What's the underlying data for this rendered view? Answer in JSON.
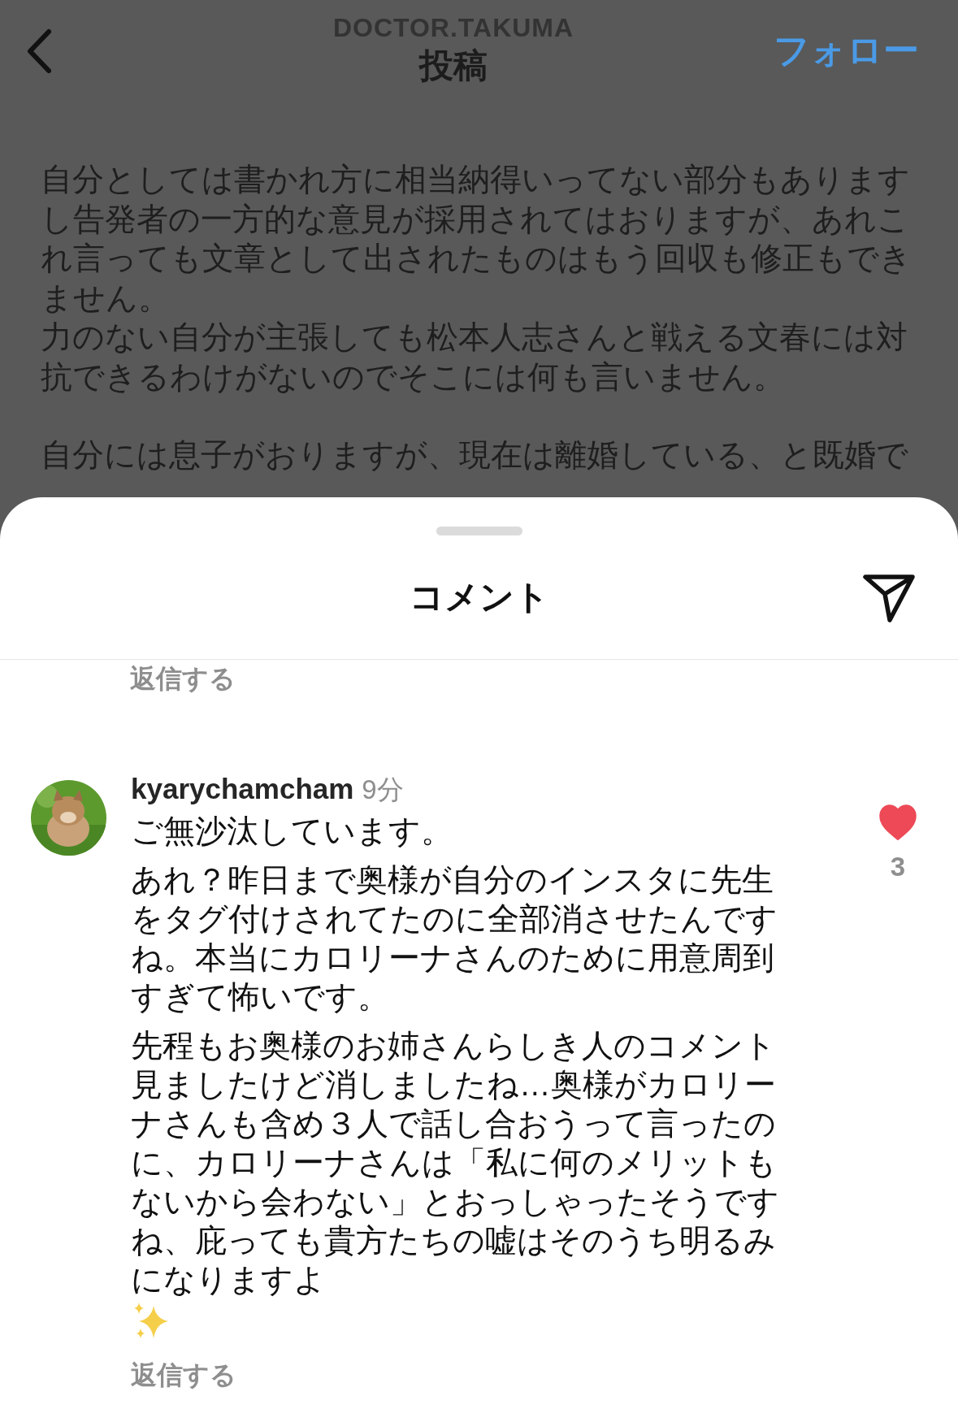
{
  "header": {
    "account": "DOCTOR.TAKUMA",
    "title": "投稿",
    "follow": "フォロー"
  },
  "post": {
    "sections": [
      [
        "自分としては書かれ方に相当納得いってない部分もありますし告発者の一方的な意見が採用されてはおりますが、あれこれ言っても文章として出されたものはもう回収も修正もできません。",
        "力のない自分が主張しても松本人志さんと戦える文春には対抗できるわけがないのでそこには何も言いません。"
      ],
      [
        "自分には息子がおりますが、現在は離婚している、と既婚で"
      ]
    ]
  },
  "comments_sheet": {
    "title": "コメント",
    "previous_reply": "返信する",
    "comments": [
      {
        "username": "kyarychamcham",
        "time": "9分",
        "paragraphs": [
          "ご無沙汰しています。",
          "あれ？昨日まで奥様が自分のインスタに先生をタグ付けされてたのに全部消させたんですね。本当にカロリーナさんのために用意周到すぎて怖いです。",
          "先程もお奥様のお姉さんらしき人のコメント見ましたけど消しましたね…奥様がカロリーナさんも含め３人で話し合おうって言ったのに、カロリーナさんは「私に何のメリットもないから会わない」とおっしゃったそうですね、庇っても貴方たちの嘘はそのうち明るみになりますよ"
        ],
        "reply": "返信する",
        "liked": true,
        "likes": "3"
      }
    ]
  }
}
